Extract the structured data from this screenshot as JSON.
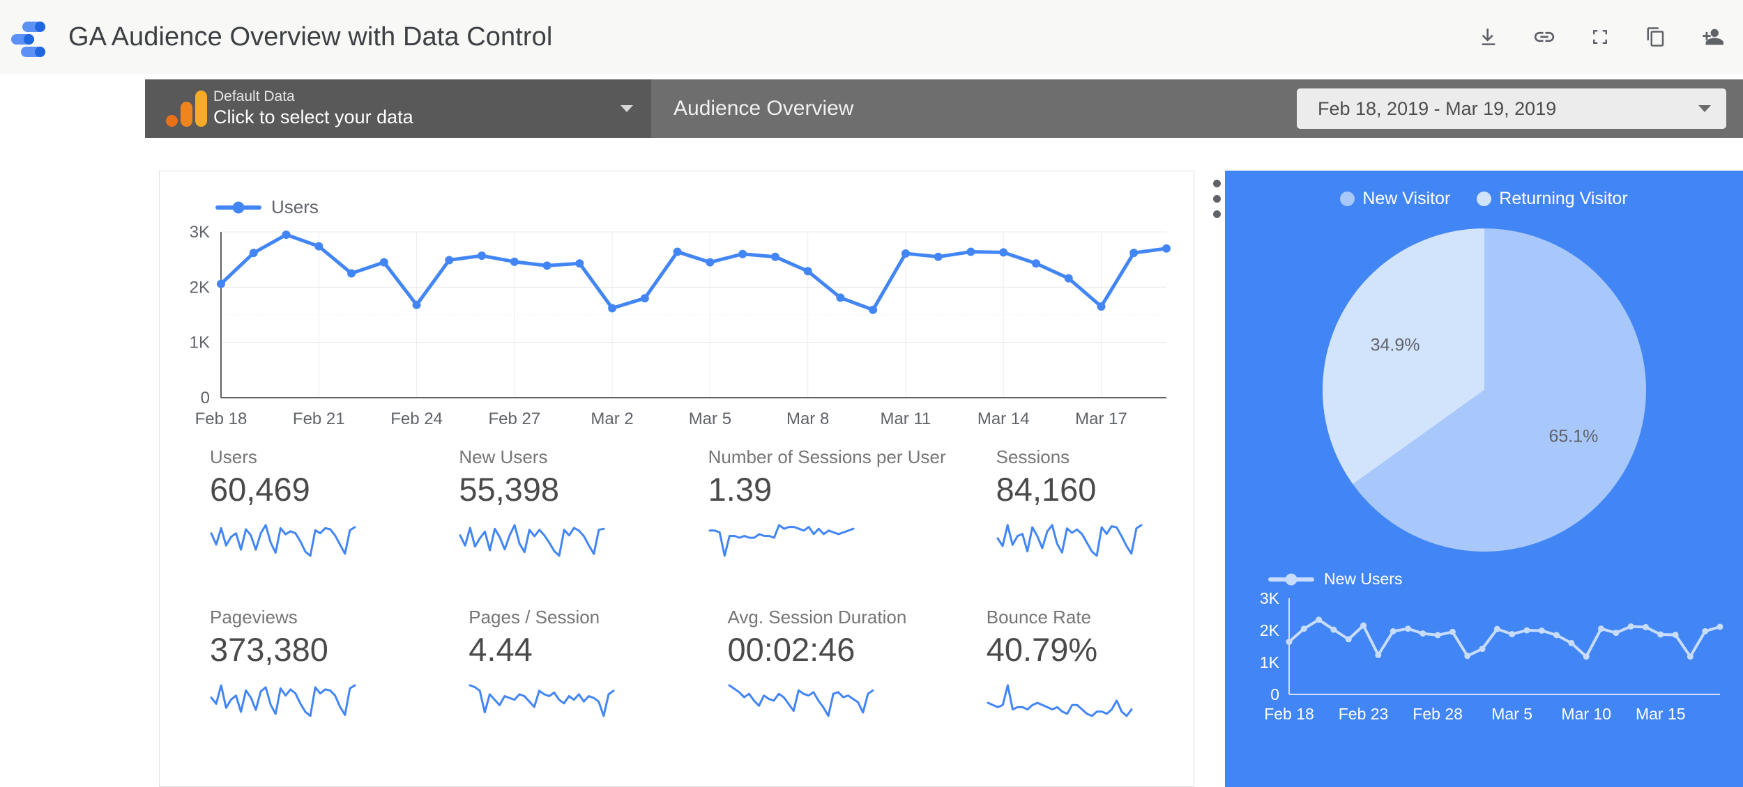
{
  "app": {
    "title": "GA Audience Overview with Data Control",
    "logo_icon": "data-studio-logo",
    "actions": [
      {
        "name": "download-icon",
        "label": "Download"
      },
      {
        "name": "link-icon",
        "label": "Get report link"
      },
      {
        "name": "fullscreen-icon",
        "label": "Full screen"
      },
      {
        "name": "copy-icon",
        "label": "Make a copy"
      },
      {
        "name": "add-person-icon",
        "label": "Share"
      }
    ]
  },
  "control_strip": {
    "data_control": {
      "icon": "google-analytics-icon",
      "label": "Default Data",
      "value": "Click to select your data",
      "caret": "chevron-down-icon"
    },
    "page_title": "Audience Overview",
    "date_range": {
      "value": "Feb 18, 2019 - Mar 19, 2019",
      "caret": "chevron-down-icon"
    }
  },
  "report": {
    "kebab_menu": "more-options-icon",
    "scorecards": [
      {
        "label": "Users",
        "value": "60,469"
      },
      {
        "label": "New Users",
        "value": "55,398"
      },
      {
        "label": "Number of Sessions per User",
        "value": "1.39"
      },
      {
        "label": "Sessions",
        "value": "84,160"
      },
      {
        "label": "Pageviews",
        "value": "373,380"
      },
      {
        "label": "Pages / Session",
        "value": "4.44"
      },
      {
        "label": "Avg. Session Duration",
        "value": "00:02:46"
      },
      {
        "label": "Bounce Rate",
        "value": "40.79%"
      }
    ]
  },
  "colors": {
    "accent_blue": "#4285f4",
    "panel_blue": "#4285f4",
    "pie_new_visitor": "#a8c7fa",
    "pie_returning_visitor": "#d2e3fc",
    "ga_orange": "#f9ab28",
    "strip_grey": "#6e6e6e",
    "data_control_grey": "#595959"
  },
  "chart_data": [
    {
      "id": "users-timeseries",
      "type": "line",
      "title": "",
      "legend": [
        "Users"
      ],
      "legend_position": "top-left",
      "xlabel": "",
      "ylabel": "",
      "ylim": [
        0,
        3000
      ],
      "yticks": [
        0,
        1000,
        2000,
        3000
      ],
      "ytick_labels": [
        "0",
        "1K",
        "2K",
        "3K"
      ],
      "grid": true,
      "xtick_labels": [
        "Feb 18",
        "Feb 21",
        "Feb 24",
        "Feb 27",
        "Mar 2",
        "Mar 5",
        "Mar 8",
        "Mar 11",
        "Mar 14",
        "Mar 17"
      ],
      "x": [
        "Feb 18",
        "Feb 19",
        "Feb 20",
        "Feb 21",
        "Feb 22",
        "Feb 23",
        "Feb 24",
        "Feb 25",
        "Feb 26",
        "Feb 27",
        "Feb 28",
        "Mar 1",
        "Mar 2",
        "Mar 3",
        "Mar 4",
        "Mar 5",
        "Mar 6",
        "Mar 7",
        "Mar 8",
        "Mar 9",
        "Mar 10",
        "Mar 11",
        "Mar 12",
        "Mar 13",
        "Mar 14",
        "Mar 15",
        "Mar 16",
        "Mar 17",
        "Mar 18",
        "Mar 19"
      ],
      "series": [
        {
          "name": "Users",
          "color": "#4285f4",
          "values": [
            2060,
            2620,
            2950,
            2740,
            2250,
            2450,
            1680,
            2490,
            2570,
            2460,
            2390,
            2430,
            1620,
            1800,
            2640,
            2450,
            2600,
            2550,
            2290,
            1810,
            1590,
            2610,
            2550,
            2640,
            2630,
            2430,
            2160,
            1650,
            2620,
            2700
          ]
        }
      ]
    },
    {
      "id": "visitor-type-pie",
      "type": "pie",
      "title": "",
      "legend_position": "top",
      "labels": [
        "New Visitor",
        "Returning Visitor"
      ],
      "values": [
        65.1,
        34.9
      ],
      "value_labels": [
        "65.1%",
        "34.9%"
      ],
      "colors": [
        "#a8c7fa",
        "#d2e3fc"
      ]
    },
    {
      "id": "new-users-timeseries",
      "type": "line",
      "title": "",
      "legend": [
        "New Users"
      ],
      "legend_position": "top-left",
      "xlabel": "",
      "ylabel": "",
      "ylim": [
        0,
        3000
      ],
      "yticks": [
        0,
        1000,
        2000,
        3000
      ],
      "ytick_labels": [
        "0",
        "1K",
        "2K",
        "3K"
      ],
      "grid": false,
      "xtick_labels": [
        "Feb 18",
        "Feb 23",
        "Feb 28",
        "Mar 5",
        "Mar 10",
        "Mar 15"
      ],
      "x": [
        "Feb 18",
        "Feb 19",
        "Feb 20",
        "Feb 21",
        "Feb 22",
        "Feb 23",
        "Feb 24",
        "Feb 25",
        "Feb 26",
        "Feb 27",
        "Feb 28",
        "Mar 1",
        "Mar 2",
        "Mar 3",
        "Mar 4",
        "Mar 5",
        "Mar 6",
        "Mar 7",
        "Mar 8",
        "Mar 9",
        "Mar 10",
        "Mar 11",
        "Mar 12",
        "Mar 13",
        "Mar 14",
        "Mar 15",
        "Mar 16",
        "Mar 17",
        "Mar 18",
        "Mar 19"
      ],
      "series": [
        {
          "name": "New Users",
          "color": "#c8ddfd",
          "values": [
            1640,
            2050,
            2330,
            2020,
            1720,
            2150,
            1230,
            1970,
            2050,
            1900,
            1850,
            1950,
            1200,
            1420,
            2040,
            1880,
            2000,
            1990,
            1850,
            1600,
            1180,
            2050,
            1920,
            2120,
            2100,
            1870,
            1860,
            1180,
            1970,
            2110
          ]
        }
      ]
    },
    {
      "id": "sparkline-users",
      "type": "line",
      "values": [
        62,
        40,
        72,
        38,
        55,
        62,
        30,
        70,
        58,
        30,
        62,
        78,
        44,
        24,
        72,
        60,
        66,
        62,
        46,
        26,
        18,
        68,
        62,
        72,
        70,
        58,
        40,
        22,
        68,
        74
      ]
    },
    {
      "id": "sparkline-new-users",
      "type": "line",
      "values": [
        58,
        36,
        74,
        34,
        52,
        66,
        26,
        72,
        54,
        28,
        58,
        80,
        40,
        22,
        70,
        56,
        70,
        58,
        42,
        24,
        14,
        70,
        58,
        74,
        68,
        56,
        36,
        18,
        70,
        72
      ]
    },
    {
      "id": "sparkline-sessions-per-user",
      "type": "line",
      "values": [
        58,
        58,
        56,
        30,
        52,
        52,
        50,
        52,
        50,
        50,
        54,
        52,
        52,
        50,
        64,
        60,
        62,
        62,
        60,
        58,
        62,
        54,
        60,
        54,
        58,
        56,
        54,
        56,
        58,
        60
      ]
    },
    {
      "id": "sparkline-sessions",
      "type": "line",
      "values": [
        52,
        38,
        76,
        40,
        56,
        60,
        28,
        72,
        56,
        34,
        64,
        76,
        42,
        26,
        70,
        62,
        68,
        60,
        44,
        28,
        20,
        72,
        60,
        74,
        72,
        56,
        38,
        24,
        70,
        76
      ]
    },
    {
      "id": "sparkline-pageviews",
      "type": "line",
      "values": [
        54,
        42,
        78,
        34,
        50,
        58,
        26,
        68,
        54,
        30,
        66,
        74,
        40,
        22,
        72,
        58,
        70,
        62,
        42,
        26,
        18,
        74,
        62,
        70,
        68,
        58,
        36,
        20,
        72,
        78
      ]
    },
    {
      "id": "sparkline-pages-per-session",
      "type": "line",
      "values": [
        68,
        66,
        62,
        38,
        58,
        52,
        46,
        56,
        54,
        52,
        58,
        56,
        50,
        44,
        62,
        58,
        56,
        60,
        52,
        48,
        56,
        52,
        58,
        50,
        56,
        54,
        50,
        34,
        58,
        62
      ]
    },
    {
      "id": "sparkline-avg-session-duration",
      "type": "line",
      "values": [
        66,
        62,
        58,
        52,
        56,
        48,
        42,
        54,
        50,
        48,
        56,
        52,
        44,
        36,
        60,
        56,
        54,
        58,
        48,
        40,
        30,
        56,
        58,
        52,
        54,
        50,
        46,
        34,
        56,
        60
      ]
    },
    {
      "id": "sparkline-bounce-rate",
      "type": "line",
      "values": [
        52,
        50,
        48,
        50,
        68,
        46,
        48,
        48,
        46,
        50,
        52,
        50,
        48,
        46,
        48,
        44,
        42,
        50,
        50,
        46,
        42,
        40,
        44,
        44,
        42,
        46,
        54,
        44,
        40,
        46
      ]
    }
  ]
}
